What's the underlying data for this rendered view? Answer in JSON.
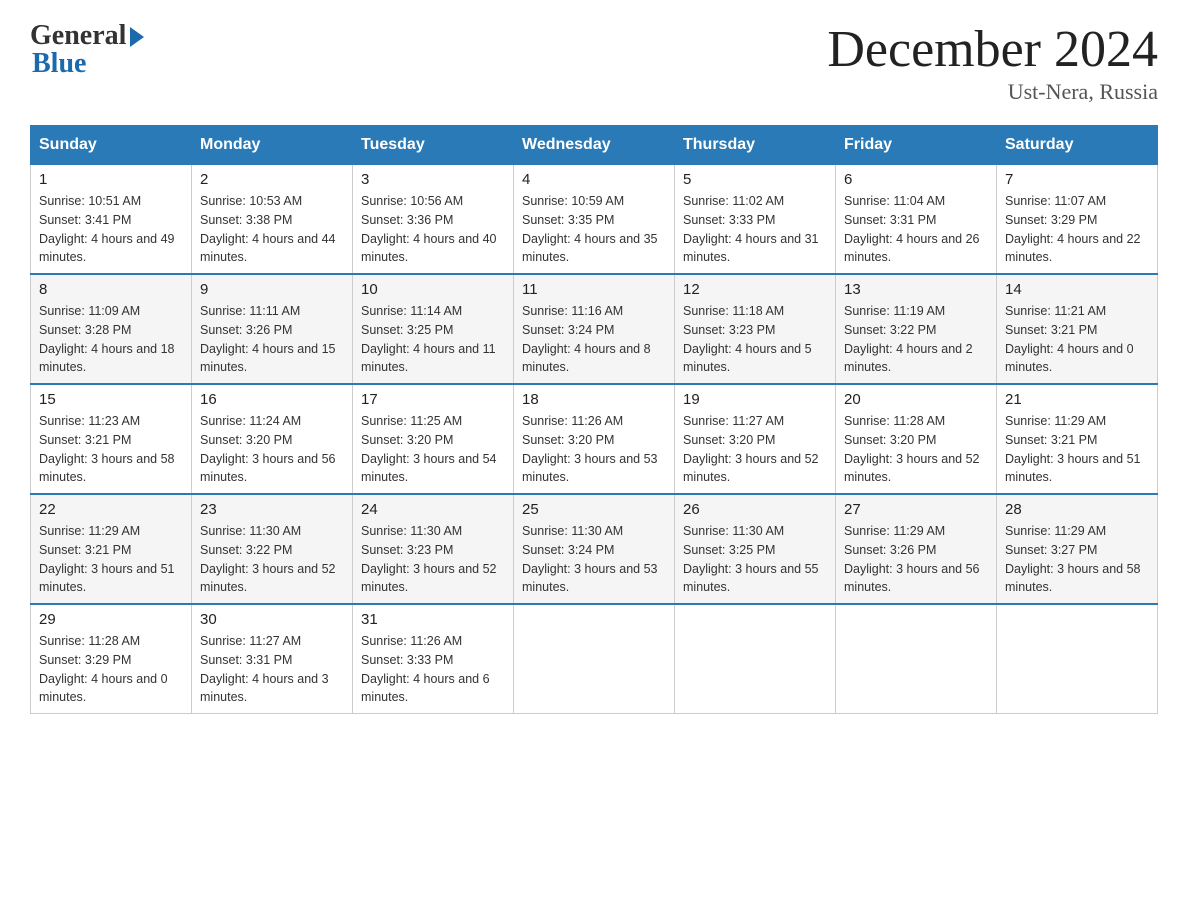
{
  "header": {
    "logo_general": "General",
    "logo_blue": "Blue",
    "month_title": "December 2024",
    "location": "Ust-Nera, Russia"
  },
  "days_of_week": [
    "Sunday",
    "Monday",
    "Tuesday",
    "Wednesday",
    "Thursday",
    "Friday",
    "Saturday"
  ],
  "weeks": [
    [
      {
        "day": "1",
        "sunrise": "Sunrise: 10:51 AM",
        "sunset": "Sunset: 3:41 PM",
        "daylight": "Daylight: 4 hours and 49 minutes."
      },
      {
        "day": "2",
        "sunrise": "Sunrise: 10:53 AM",
        "sunset": "Sunset: 3:38 PM",
        "daylight": "Daylight: 4 hours and 44 minutes."
      },
      {
        "day": "3",
        "sunrise": "Sunrise: 10:56 AM",
        "sunset": "Sunset: 3:36 PM",
        "daylight": "Daylight: 4 hours and 40 minutes."
      },
      {
        "day": "4",
        "sunrise": "Sunrise: 10:59 AM",
        "sunset": "Sunset: 3:35 PM",
        "daylight": "Daylight: 4 hours and 35 minutes."
      },
      {
        "day": "5",
        "sunrise": "Sunrise: 11:02 AM",
        "sunset": "Sunset: 3:33 PM",
        "daylight": "Daylight: 4 hours and 31 minutes."
      },
      {
        "day": "6",
        "sunrise": "Sunrise: 11:04 AM",
        "sunset": "Sunset: 3:31 PM",
        "daylight": "Daylight: 4 hours and 26 minutes."
      },
      {
        "day": "7",
        "sunrise": "Sunrise: 11:07 AM",
        "sunset": "Sunset: 3:29 PM",
        "daylight": "Daylight: 4 hours and 22 minutes."
      }
    ],
    [
      {
        "day": "8",
        "sunrise": "Sunrise: 11:09 AM",
        "sunset": "Sunset: 3:28 PM",
        "daylight": "Daylight: 4 hours and 18 minutes."
      },
      {
        "day": "9",
        "sunrise": "Sunrise: 11:11 AM",
        "sunset": "Sunset: 3:26 PM",
        "daylight": "Daylight: 4 hours and 15 minutes."
      },
      {
        "day": "10",
        "sunrise": "Sunrise: 11:14 AM",
        "sunset": "Sunset: 3:25 PM",
        "daylight": "Daylight: 4 hours and 11 minutes."
      },
      {
        "day": "11",
        "sunrise": "Sunrise: 11:16 AM",
        "sunset": "Sunset: 3:24 PM",
        "daylight": "Daylight: 4 hours and 8 minutes."
      },
      {
        "day": "12",
        "sunrise": "Sunrise: 11:18 AM",
        "sunset": "Sunset: 3:23 PM",
        "daylight": "Daylight: 4 hours and 5 minutes."
      },
      {
        "day": "13",
        "sunrise": "Sunrise: 11:19 AM",
        "sunset": "Sunset: 3:22 PM",
        "daylight": "Daylight: 4 hours and 2 minutes."
      },
      {
        "day": "14",
        "sunrise": "Sunrise: 11:21 AM",
        "sunset": "Sunset: 3:21 PM",
        "daylight": "Daylight: 4 hours and 0 minutes."
      }
    ],
    [
      {
        "day": "15",
        "sunrise": "Sunrise: 11:23 AM",
        "sunset": "Sunset: 3:21 PM",
        "daylight": "Daylight: 3 hours and 58 minutes."
      },
      {
        "day": "16",
        "sunrise": "Sunrise: 11:24 AM",
        "sunset": "Sunset: 3:20 PM",
        "daylight": "Daylight: 3 hours and 56 minutes."
      },
      {
        "day": "17",
        "sunrise": "Sunrise: 11:25 AM",
        "sunset": "Sunset: 3:20 PM",
        "daylight": "Daylight: 3 hours and 54 minutes."
      },
      {
        "day": "18",
        "sunrise": "Sunrise: 11:26 AM",
        "sunset": "Sunset: 3:20 PM",
        "daylight": "Daylight: 3 hours and 53 minutes."
      },
      {
        "day": "19",
        "sunrise": "Sunrise: 11:27 AM",
        "sunset": "Sunset: 3:20 PM",
        "daylight": "Daylight: 3 hours and 52 minutes."
      },
      {
        "day": "20",
        "sunrise": "Sunrise: 11:28 AM",
        "sunset": "Sunset: 3:20 PM",
        "daylight": "Daylight: 3 hours and 52 minutes."
      },
      {
        "day": "21",
        "sunrise": "Sunrise: 11:29 AM",
        "sunset": "Sunset: 3:21 PM",
        "daylight": "Daylight: 3 hours and 51 minutes."
      }
    ],
    [
      {
        "day": "22",
        "sunrise": "Sunrise: 11:29 AM",
        "sunset": "Sunset: 3:21 PM",
        "daylight": "Daylight: 3 hours and 51 minutes."
      },
      {
        "day": "23",
        "sunrise": "Sunrise: 11:30 AM",
        "sunset": "Sunset: 3:22 PM",
        "daylight": "Daylight: 3 hours and 52 minutes."
      },
      {
        "day": "24",
        "sunrise": "Sunrise: 11:30 AM",
        "sunset": "Sunset: 3:23 PM",
        "daylight": "Daylight: 3 hours and 52 minutes."
      },
      {
        "day": "25",
        "sunrise": "Sunrise: 11:30 AM",
        "sunset": "Sunset: 3:24 PM",
        "daylight": "Daylight: 3 hours and 53 minutes."
      },
      {
        "day": "26",
        "sunrise": "Sunrise: 11:30 AM",
        "sunset": "Sunset: 3:25 PM",
        "daylight": "Daylight: 3 hours and 55 minutes."
      },
      {
        "day": "27",
        "sunrise": "Sunrise: 11:29 AM",
        "sunset": "Sunset: 3:26 PM",
        "daylight": "Daylight: 3 hours and 56 minutes."
      },
      {
        "day": "28",
        "sunrise": "Sunrise: 11:29 AM",
        "sunset": "Sunset: 3:27 PM",
        "daylight": "Daylight: 3 hours and 58 minutes."
      }
    ],
    [
      {
        "day": "29",
        "sunrise": "Sunrise: 11:28 AM",
        "sunset": "Sunset: 3:29 PM",
        "daylight": "Daylight: 4 hours and 0 minutes."
      },
      {
        "day": "30",
        "sunrise": "Sunrise: 11:27 AM",
        "sunset": "Sunset: 3:31 PM",
        "daylight": "Daylight: 4 hours and 3 minutes."
      },
      {
        "day": "31",
        "sunrise": "Sunrise: 11:26 AM",
        "sunset": "Sunset: 3:33 PM",
        "daylight": "Daylight: 4 hours and 6 minutes."
      },
      null,
      null,
      null,
      null
    ]
  ]
}
